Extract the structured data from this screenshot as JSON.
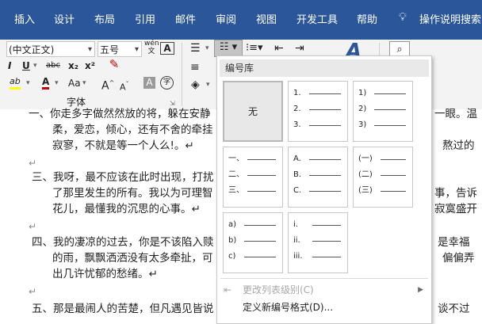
{
  "ribbon_tabs": [
    "插入",
    "设计",
    "布局",
    "引用",
    "邮件",
    "审阅",
    "视图",
    "开发工具",
    "帮助"
  ],
  "tell_me": "操作说明搜索",
  "font": {
    "name": "(中文正文)",
    "size": "五号",
    "group_label": "字体"
  },
  "ribbon_glyphs": {
    "bold": "I",
    "underline": "U",
    "strike": "abc",
    "sub": "x₂",
    "sup": "x²",
    "font_color": "A",
    "highlight": "ab",
    "case": "Aa",
    "grow": "A",
    "shrink": "A",
    "char_shade": "A",
    "enclose": "字",
    "phonetic": "wén"
  },
  "document": {
    "lines": [
      {
        "text": "一、你走多字做然然放的将，躲在安静",
        "num": false
      },
      {
        "text": "柔，爱恋，倾心，还有不舍的牵挂",
        "num": false
      },
      {
        "text": "寂寥，不就是等一个人么!。↵",
        "num": false
      },
      {
        "text": "↵",
        "num": false
      },
      {
        "text": "三、我呀，最不应该在此时出现，打扰",
        "num": true
      },
      {
        "text": "了那里发生的所有。我以为可理智",
        "num": false
      },
      {
        "text": "花儿，最懂我的沉思的心事。↵",
        "num": false
      },
      {
        "text": "↵",
        "num": false
      },
      {
        "text": "四、我的凄凉的过去，你是不该陷入赎",
        "num": true
      },
      {
        "text": "的雨，飘飘洒洒没有太多牵扯，可",
        "num": false
      },
      {
        "text": "出几许忧郁的愁绪。↵",
        "num": false
      },
      {
        "text": "↵",
        "num": false
      },
      {
        "text": "五、那是最闹人的苦楚，但凡遇见皆说",
        "num": true
      }
    ],
    "right_fragments": [
      {
        "text": "一眼。温"
      },
      {
        "text": "熬过的"
      },
      {
        "text": "事，告诉"
      },
      {
        "text": "寂寞盛开"
      },
      {
        "text": "是幸福"
      },
      {
        "text": "偏偏弄"
      },
      {
        "text": "谈不过"
      }
    ]
  },
  "numbering_menu": {
    "header": "编号库",
    "none_label": "无",
    "formats": [
      [
        "1.",
        "2.",
        "3."
      ],
      [
        "1)",
        "2)",
        "3)"
      ],
      [
        "一、",
        "二、",
        "三、"
      ],
      [
        "A.",
        "B.",
        "C."
      ],
      [
        "(一)",
        "(二)",
        "(三)"
      ],
      [
        "a)",
        "b)",
        "c)"
      ],
      [
        "i.",
        "ii.",
        "iii."
      ]
    ],
    "change_level": "更改列表级别(C)",
    "define_new": "定义新编号格式(D)..."
  },
  "colors": {
    "ribbon_blue": "#2b579a",
    "font_red": "#c00000",
    "highlight_yellow": "#ffff00",
    "accent": "#2b579a"
  }
}
